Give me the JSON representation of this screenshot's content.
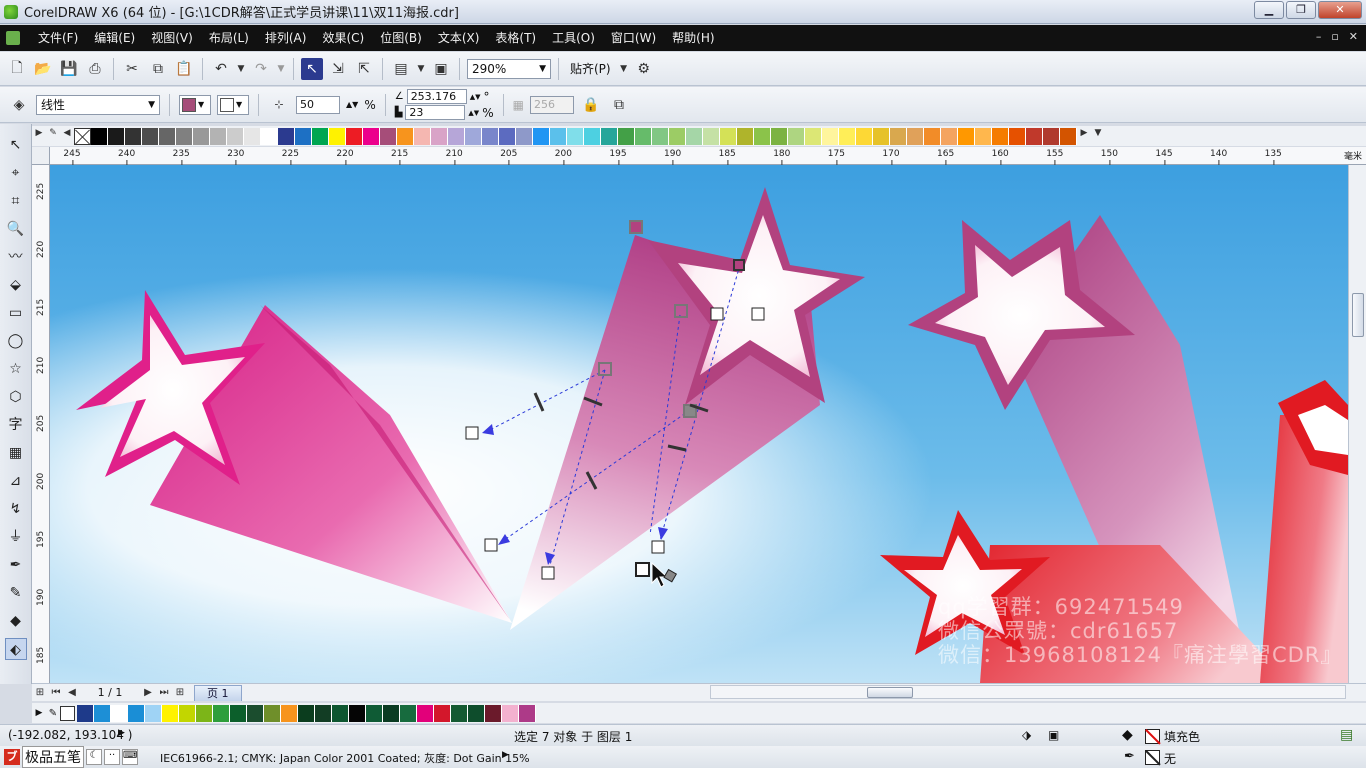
{
  "window": {
    "title": "CorelDRAW X6 (64 位) - [G:\\1CDR解答\\正式学员讲课\\11\\双11海报.cdr]",
    "buttons": {
      "minimize": "▁",
      "restore": "❐",
      "close": "✕"
    }
  },
  "menu": {
    "items": [
      "文件(F)",
      "编辑(E)",
      "视图(V)",
      "布局(L)",
      "排列(A)",
      "效果(C)",
      "位图(B)",
      "文本(X)",
      "表格(T)",
      "工具(O)",
      "窗口(W)",
      "帮助(H)"
    ],
    "mdi": {
      "minimize": "–",
      "restore": "▫",
      "close": "✕"
    }
  },
  "toolbar": {
    "zoom": "290%",
    "snap_label": "贴齐(P)"
  },
  "propbar": {
    "fill_type": "线性",
    "midpoint_value": "50",
    "percent_sign": "%",
    "angle_value": "253.176",
    "angle_unit": "°",
    "edge_pad_value": "23",
    "edge_pad_unit": "%",
    "steps_value": "256"
  },
  "palette": {
    "colors": [
      "#000000",
      "#1a1a1a",
      "#333333",
      "#4d4d4d",
      "#666666",
      "#808080",
      "#999999",
      "#b3b3b3",
      "#cccccc",
      "#e6e6e6",
      "#ffffff",
      "#2b3a8f",
      "#1d70c4",
      "#00a651",
      "#fff200",
      "#ed1c24",
      "#ec008c",
      "#a64d79",
      "#f7941d",
      "#f5b7b1",
      "#d9a3c7",
      "#b6a6d8",
      "#9fa8da",
      "#7986cb",
      "#5c6bc0",
      "#8e99c9",
      "#2196f3",
      "#5bc0eb",
      "#80deea",
      "#4dd0e1",
      "#26a69a",
      "#43a047",
      "#66bb6a",
      "#81c784",
      "#9ccc65",
      "#a5d6a7",
      "#c5e1a5",
      "#d4e157",
      "#afb42b",
      "#8bc34a",
      "#7cb342",
      "#aed581",
      "#dce775",
      "#fff59d",
      "#ffee58",
      "#fdd835",
      "#e6c229",
      "#d9a84e",
      "#e0a15a",
      "#f28c28",
      "#f4a460",
      "#ff9800",
      "#ffb74d",
      "#f57c00",
      "#e65100",
      "#c0392b",
      "#b03a2e",
      "#d35400"
    ]
  },
  "rulers": {
    "h_ticks": [
      "245",
      "240",
      "235",
      "230",
      "225",
      "220",
      "215",
      "210",
      "205",
      "200",
      "195",
      "190",
      "185",
      "180",
      "175",
      "170",
      "165",
      "160",
      "155",
      "150",
      "145",
      "140",
      "135"
    ],
    "h_unit": "毫米",
    "v_ticks": [
      "225",
      "220",
      "215",
      "210",
      "205",
      "200",
      "195",
      "190",
      "185"
    ]
  },
  "watermark": {
    "line1": "qq学習群：692471549",
    "line2": "微信公眾號：cdr61657",
    "line3": "微信：13968108124『痛注學習CDR』"
  },
  "pagenav": {
    "page_count": "1 / 1",
    "page_tab": "页 1"
  },
  "docpalette": {
    "colors": [
      "#1e3a8a",
      "#1d8fd6",
      "#ffffff",
      "#1a8ed6",
      "#9fd3f5",
      "#fff200",
      "#c2d600",
      "#7cb518",
      "#2e9e3b",
      "#0c5f2b",
      "#1b4d2e",
      "#6f8f2a",
      "#f7941d",
      "#0b3d1e",
      "#123d24",
      "#0d5630",
      "#050505",
      "#0f5b35",
      "#0a3b22",
      "#176b3e",
      "#e2007a",
      "#d3172b",
      "#145a32",
      "#0e4d2c",
      "#6b1a2b",
      "#f3b1cf",
      "#ad3a88"
    ]
  },
  "status": {
    "coords": "(-192.082, 193.104 )",
    "selection": "选定 7 对象 于 图层 1",
    "fill_label": "填充色",
    "outline_label": "无",
    "color_profile": "IEC61966-2.1; CMYK: Japan Color 2001 Coated; 灰度: Dot Gain 15%",
    "ime_name": "极品五笔"
  }
}
